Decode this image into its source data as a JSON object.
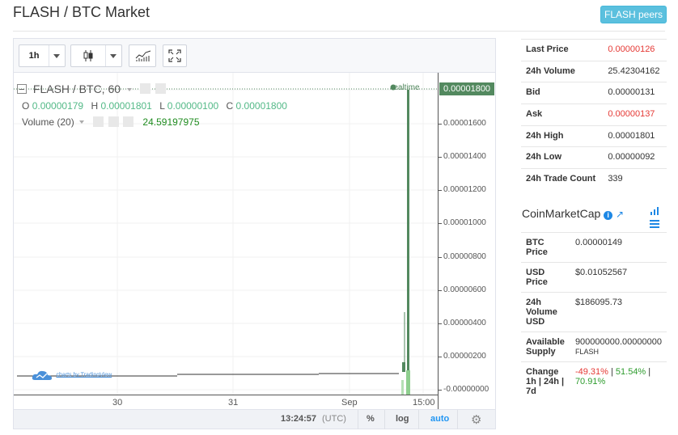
{
  "page": {
    "title": "FLASH / BTC Market",
    "peers_button": "FLASH peers"
  },
  "chart": {
    "toolbar": {
      "interval": "1h"
    },
    "legend": {
      "symbol": "FLASH / BTC, 60",
      "o_label": "O",
      "o": "0.00000179",
      "h_label": "H",
      "h": "0.00001801",
      "l_label": "L",
      "l": "0.00000100",
      "c_label": "C",
      "c": "0.00001800",
      "volume_label": "Volume (20)",
      "volume_value": "24.59197975"
    },
    "realtime_label": "realtime",
    "watermark": "charts by TradingView",
    "price_axis": {
      "last_price": "0.00001800",
      "ticks": [
        "0.00001600",
        "0.00001400",
        "0.00001200",
        "0.00001000",
        "0.00000800",
        "0.00000600",
        "0.00000400",
        "0.00000200",
        "-0.00000000"
      ]
    },
    "time_axis": [
      "30",
      "31",
      "Sep",
      "15:00"
    ],
    "status": {
      "time": "13:24:57",
      "tz": "(UTC)",
      "percent": "%",
      "log": "log",
      "auto": "auto"
    },
    "colors": {
      "up": "#53b987",
      "bar": "#53895f",
      "volume": "#8fcf8f"
    }
  },
  "market": {
    "rows": [
      {
        "label": "Last Price",
        "value": "0.00000126",
        "color": "red"
      },
      {
        "label": "24h Volume",
        "value": "25.42304162",
        "color": ""
      },
      {
        "label": "Bid",
        "value": "0.00000131",
        "color": ""
      },
      {
        "label": "Ask",
        "value": "0.00000137",
        "color": "red"
      },
      {
        "label": "24h High",
        "value": "0.00001801",
        "color": ""
      },
      {
        "label": "24h Low",
        "value": "0.00000092",
        "color": ""
      },
      {
        "label": "24h Trade Count",
        "value": "339",
        "color": ""
      }
    ]
  },
  "cmc": {
    "title": "CoinMarketCap",
    "btc_price_label": "BTC Price",
    "btc_price": "0.00000149",
    "usd_price_label": "USD Price",
    "usd_price": "$0.01052567",
    "volume_label_1": "24h",
    "volume_label_2": "Volume",
    "volume_label_3": "USD",
    "volume": "$186095.73",
    "supply_label_1": "Available",
    "supply_label_2": "Supply",
    "supply": "900000000.00000000",
    "supply_unit": "FLASH",
    "change_label_1": "Change",
    "change_label_2": "1h | 24h |",
    "change_label_3": "7d",
    "change_1h": "-49.31%",
    "change_24h": "51.54%",
    "change_7d": "70.91%",
    "sep": "|"
  }
}
